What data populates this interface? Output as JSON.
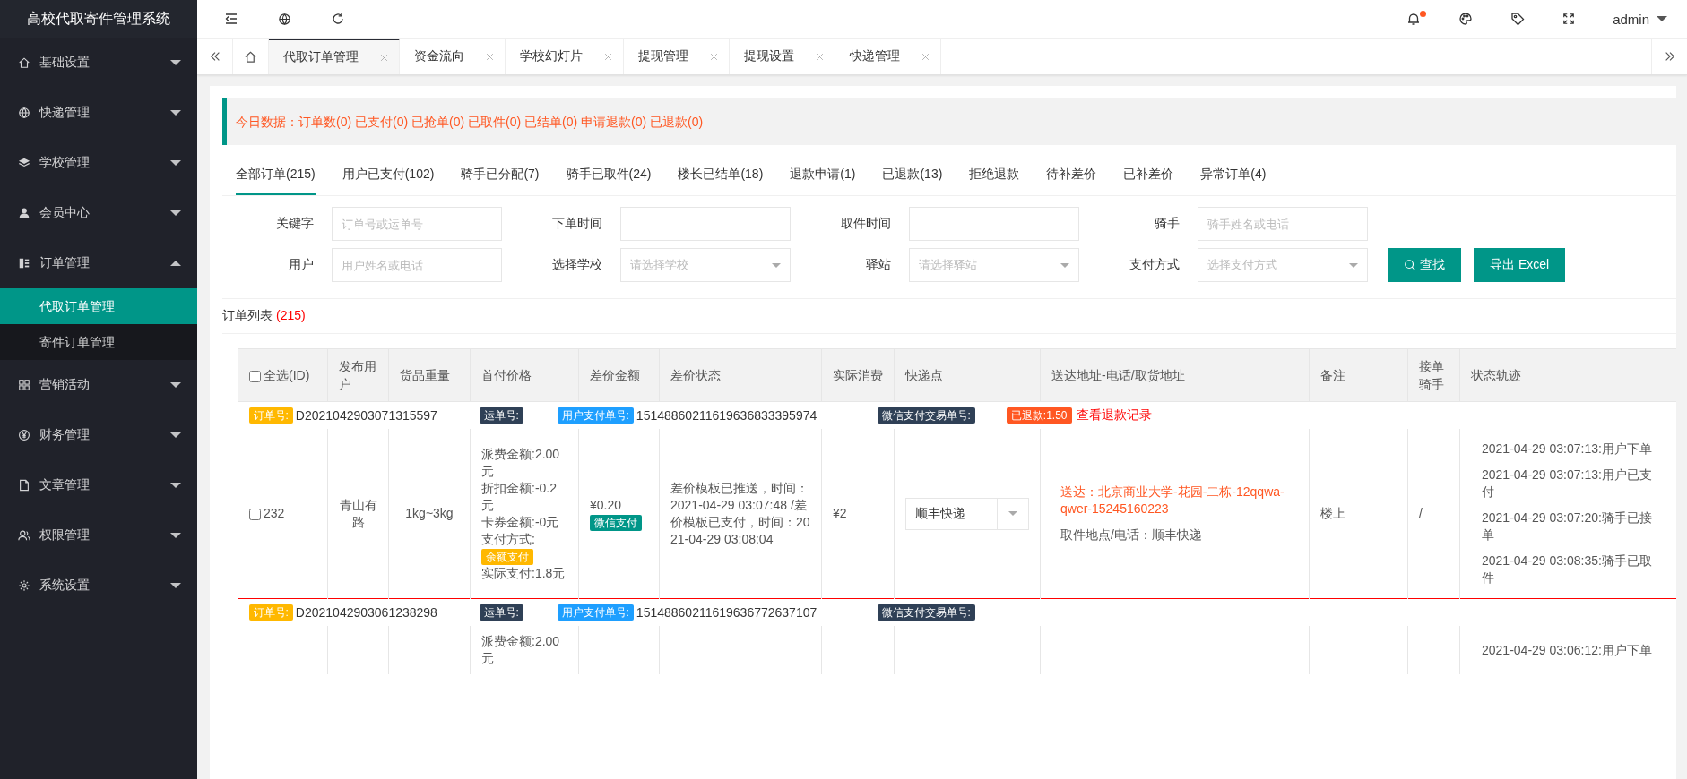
{
  "app_title": "高校代取寄件管理系统",
  "sidebar": {
    "items": [
      {
        "label": "基础设置",
        "expanded": false
      },
      {
        "label": "快递管理",
        "expanded": false
      },
      {
        "label": "学校管理",
        "expanded": false
      },
      {
        "label": "会员中心",
        "expanded": false
      },
      {
        "label": "订单管理",
        "expanded": true,
        "children": [
          {
            "label": "代取订单管理",
            "selected": true
          },
          {
            "label": "寄件订单管理",
            "selected": false
          }
        ]
      },
      {
        "label": "营销活动",
        "expanded": false
      },
      {
        "label": "财务管理",
        "expanded": false
      },
      {
        "label": "文章管理",
        "expanded": false
      },
      {
        "label": "权限管理",
        "expanded": false
      },
      {
        "label": "系统设置",
        "expanded": false
      }
    ]
  },
  "top_bar": {
    "user": "admin",
    "notification_dot": true
  },
  "page_tabs": [
    {
      "label": "代取订单管理",
      "selected": true
    },
    {
      "label": "资金流向",
      "selected": false
    },
    {
      "label": "学校幻灯片",
      "selected": false
    },
    {
      "label": "提现管理",
      "selected": false
    },
    {
      "label": "提现设置",
      "selected": false
    },
    {
      "label": "快递管理",
      "selected": false
    }
  ],
  "today_stats": "今日数据：订单数(0) 已支付(0) 已抢单(0) 已取件(0) 已结单(0) 申请退款(0) 已退款(0)",
  "status_tabs": [
    {
      "label": "全部订单(215)",
      "selected": true
    },
    {
      "label": "用户已支付(102)",
      "selected": false
    },
    {
      "label": "骑手已分配(7)",
      "selected": false
    },
    {
      "label": "骑手已取件(24)",
      "selected": false
    },
    {
      "label": "楼长已结单(18)",
      "selected": false
    },
    {
      "label": "退款申请(1)",
      "selected": false
    },
    {
      "label": "已退款(13)",
      "selected": false
    },
    {
      "label": "拒绝退款",
      "selected": false
    },
    {
      "label": "待补差价",
      "selected": false
    },
    {
      "label": "已补差价",
      "selected": false
    },
    {
      "label": "异常订单(4)",
      "selected": false
    }
  ],
  "filters": [
    {
      "label": "关键字",
      "kind": "text",
      "placeholder": "订单号或运单号"
    },
    {
      "label": "下单时间",
      "kind": "text"
    },
    {
      "label": "取件时间",
      "kind": "text"
    },
    {
      "label": "骑手",
      "kind": "text",
      "placeholder": "骑手姓名或电话"
    },
    {
      "label": "用户",
      "kind": "text",
      "placeholder": "用户姓名或电话"
    },
    {
      "label": "选择学校",
      "kind": "select",
      "placeholder": "请选择学校"
    },
    {
      "label": "驿站",
      "kind": "select",
      "placeholder": "请选择驿站"
    },
    {
      "label": "支付方式",
      "kind": "select",
      "placeholder": "选择支付方式"
    }
  ],
  "buttons": [
    {
      "label": "查找",
      "kind": "search"
    },
    {
      "label": "导出 Excel",
      "kind": "export"
    }
  ],
  "list_title": "订单列表",
  "list_count": "(215)",
  "table": {
    "select_all": {
      "label": "全选(ID)",
      "checked": false
    },
    "columns": [
      "发布用户",
      "货品重量",
      "首付价格",
      "差价金额",
      "差价状态",
      "实际消费",
      "快递点",
      "送达地址-电话/取货地址",
      "备注",
      "接单骑手",
      "状态轨迹"
    ],
    "orders": [
      {
        "tags": [
          {
            "label": "订单号:",
            "value": "D2021042903071315597",
            "color": "#ffb800"
          },
          {
            "label": "运单号:",
            "color": "#2f4056"
          },
          {
            "label": "用户支付单号:",
            "value": "15148860211619636833395974",
            "color": "#1e9fff"
          },
          {
            "label": "微信支付交易单号:",
            "color": "#2f4056"
          },
          {
            "label": "已退款:1.50",
            "color": "#ff5722"
          }
        ],
        "refund_link": "查看退款记录",
        "id": "232",
        "checked": false,
        "user": "青山有路",
        "weight": "1kg~3kg",
        "price_lines": [
          "派费金额:2.00元",
          "折扣金额:-0.2元",
          "卡券金额:-0元",
          "支付方式:"
        ],
        "pay_method": "余额支付",
        "paid": "实际支付:1.8元",
        "diff_amount": "¥0.20",
        "diff_pay": "微信支付",
        "diff_status": "差价模板已推送，时间：2021-04-29 03:07:48 /差价模板已支付，时间：2021-04-29 03:08:04",
        "actual": "¥2",
        "courier": "顺丰快递",
        "address": "送达：北京商业大学-花园-二栋-12qqwa-qwer-15245160223",
        "pickup": "取件地点/电话：顺丰快递",
        "note": "楼上",
        "rider": "/",
        "track": [
          "2021-04-29 03:07:13:用户下单",
          "2021-04-29 03:07:13:用户已支付",
          "2021-04-29 03:07:20:骑手已接单",
          "2021-04-29 03:08:35:骑手已取件"
        ]
      },
      {
        "tags": [
          {
            "label": "订单号:",
            "value": "D2021042903061238298",
            "color": "#ffb800"
          },
          {
            "label": "运单号:",
            "color": "#2f4056"
          },
          {
            "label": "用户支付单号:",
            "value": "15148860211619636772637107",
            "color": "#1e9fff"
          },
          {
            "label": "微信支付交易单号:",
            "color": "#2f4056"
          }
        ],
        "price_lines": [
          "派费金额:2.00元"
        ],
        "track": [
          "2021-04-29 03:06:12:用户下单"
        ]
      }
    ]
  }
}
